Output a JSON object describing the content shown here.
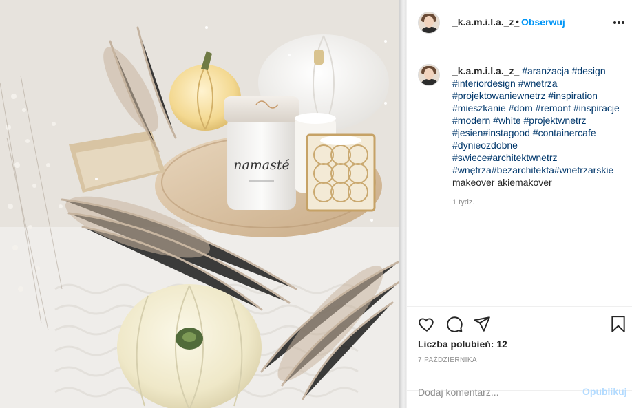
{
  "header": {
    "username": "_k.a.m.i.l.a._z_",
    "separator": "•",
    "follow_label": "Obserwuj",
    "more_icon": "more-horizontal-icon"
  },
  "photo": {
    "candle_label": "namasté",
    "alt_description": ""
  },
  "caption": {
    "username": "_k.a.m.i.l.a._z_",
    "segments": [
      {
        "text": "#aranżacja",
        "tag": true
      },
      {
        "text": " ",
        "tag": false
      },
      {
        "text": "#design",
        "tag": true
      },
      {
        "text": " ",
        "tag": false
      },
      {
        "text": "#interiordesign",
        "tag": true
      },
      {
        "text": " ",
        "tag": false
      },
      {
        "text": "#wnetrza",
        "tag": true
      },
      {
        "text": " ",
        "tag": false
      },
      {
        "text": "#projektowaniewnetrz",
        "tag": true
      },
      {
        "text": " ",
        "tag": false
      },
      {
        "text": "#inspiration",
        "tag": true
      },
      {
        "text": " ",
        "tag": false
      },
      {
        "text": "#mieszkanie",
        "tag": true
      },
      {
        "text": " ",
        "tag": false
      },
      {
        "text": "#dom",
        "tag": true
      },
      {
        "text": " ",
        "tag": false
      },
      {
        "text": "#remont",
        "tag": true
      },
      {
        "text": " ",
        "tag": false
      },
      {
        "text": "#inspiracje",
        "tag": true
      },
      {
        "text": " ",
        "tag": false
      },
      {
        "text": "#modern",
        "tag": true
      },
      {
        "text": " ",
        "tag": false
      },
      {
        "text": "#white",
        "tag": true
      },
      {
        "text": " ",
        "tag": false
      },
      {
        "text": "#projektwnetrz",
        "tag": true
      },
      {
        "text": " ",
        "tag": false
      },
      {
        "text": "#jesien",
        "tag": true
      },
      {
        "text": "#instagood",
        "tag": true
      },
      {
        "text": " ",
        "tag": false
      },
      {
        "text": "#containercafe",
        "tag": true
      },
      {
        "text": " ",
        "tag": false
      },
      {
        "text": "#dynieozdobne",
        "tag": true
      },
      {
        "text": " ",
        "tag": false
      },
      {
        "text": "#swiece",
        "tag": true
      },
      {
        "text": "#architektwnetrz",
        "tag": true
      },
      {
        "text": " ",
        "tag": false
      },
      {
        "text": "#wnętrza",
        "tag": true
      },
      {
        "text": "#bezarchitekta",
        "tag": true
      },
      {
        "text": "#wnetrzarskie",
        "tag": true
      },
      {
        "text": " ",
        "tag": false
      },
      {
        "text": "makeover akiemakover",
        "tag": false
      }
    ],
    "time_ago": "1 tydz."
  },
  "actions": {
    "like_icon": "heart-icon",
    "comment_icon": "comment-icon",
    "share_icon": "paper-plane-icon",
    "save_icon": "bookmark-icon",
    "likes_text": "Liczba polubień: 12",
    "date": "7 PAŹDZIERNIKA"
  },
  "comment": {
    "placeholder": "Dodaj komentarz...",
    "post_label": "Opublikuj"
  },
  "colors": {
    "accent": "#0095f6",
    "hashtag": "#00376b",
    "muted": "#8e8e8e",
    "post_disabled": "#b3dbff"
  }
}
